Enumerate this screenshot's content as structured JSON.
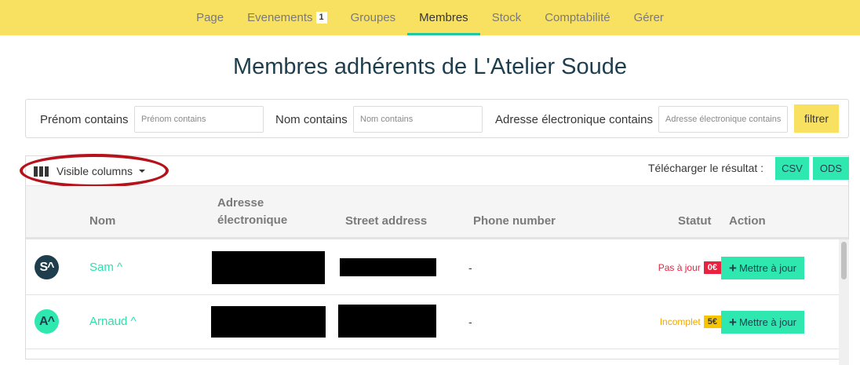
{
  "nav": {
    "items": [
      {
        "label": "Page"
      },
      {
        "label": "Evenements",
        "badge": "1"
      },
      {
        "label": "Groupes"
      },
      {
        "label": "Membres",
        "active": true
      },
      {
        "label": "Stock"
      },
      {
        "label": "Comptabilité"
      },
      {
        "label": "Gérer"
      }
    ]
  },
  "page": {
    "title": "Membres adhérents de L'Atelier Soude"
  },
  "filters": {
    "prenom_label": "Prénom contains",
    "prenom_placeholder": "Prénom contains",
    "nom_label": "Nom contains",
    "nom_placeholder": "Nom contains",
    "email_label": "Adresse électronique contains",
    "email_placeholder": "Adresse électronique contains",
    "submit_label": "filtrer"
  },
  "toolbar": {
    "visible_columns_label": "Visible columns",
    "download_label": "Télécharger le résultat :",
    "csv_label": "CSV",
    "ods_label": "ODS"
  },
  "table": {
    "headers": {
      "nom": "Nom",
      "email_line1": "Adresse",
      "email_line2": "électronique",
      "street": "Street address",
      "phone": "Phone number",
      "statut": "Statut",
      "action": "Action"
    },
    "rows": [
      {
        "avatar": "S^",
        "name": "Sam ^",
        "phone": "-",
        "status_text": "Pas à jour",
        "status_amount": "0€",
        "action_label": "Mettre à jour"
      },
      {
        "avatar": "A^",
        "name": "Arnaud ^",
        "phone": "-",
        "status_text": "Incomplet",
        "status_amount": "5€",
        "action_label": "Mettre à jour"
      }
    ]
  },
  "colors": {
    "nav_bg": "#f8e061",
    "accent": "#2ee8b0",
    "title": "#1f3e4d",
    "status_late": "#e8223f",
    "status_incomplete": "#f0a800",
    "highlight": "#b5121b"
  }
}
